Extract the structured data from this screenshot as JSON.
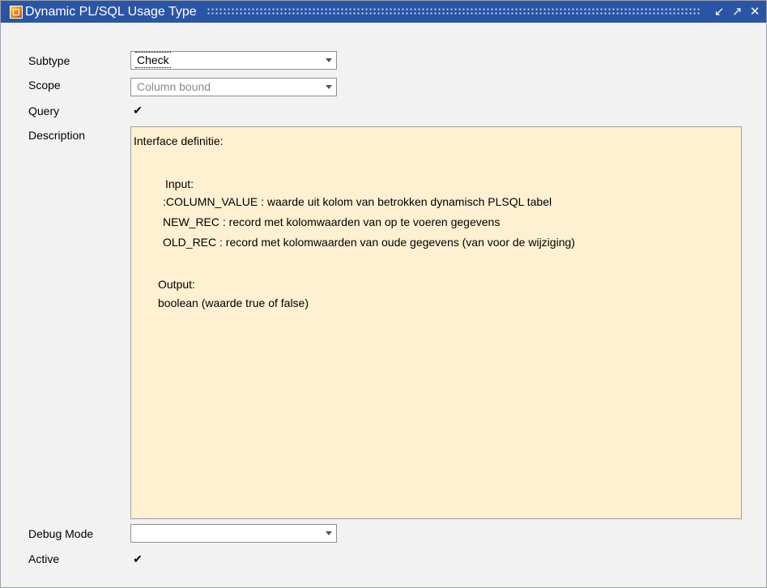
{
  "window": {
    "title": "Dynamic PL/SQL Usage Type",
    "controls": [
      "minimize-icon",
      "maximize-icon",
      "close-icon"
    ]
  },
  "form": {
    "subtype": {
      "label": "Subtype",
      "value": "Check"
    },
    "scope": {
      "label": "Scope",
      "value": "Column bound"
    },
    "query": {
      "label": "Query",
      "checked": true,
      "mark": "✔"
    },
    "description": {
      "label": "Description",
      "lines": [
        "Interface definitie:",
        "Input:",
        ":COLUMN_VALUE : waarde uit kolom van betrokken dynamisch PLSQL tabel",
        "NEW_REC : record met kolomwaarden van op te voeren gegevens",
        "OLD_REC : record met kolomwaarden van oude gegevens (van voor de wijziging)",
        "Output:",
        "boolean (waarde true of false)"
      ]
    },
    "debug_mode": {
      "label": "Debug Mode",
      "value": ""
    },
    "active": {
      "label": "Active",
      "checked": true,
      "mark": "✔"
    }
  },
  "colors": {
    "titlebar": "#2b55a4",
    "window_bg": "#f2f2f2",
    "description_bg": "#fff0d2"
  }
}
